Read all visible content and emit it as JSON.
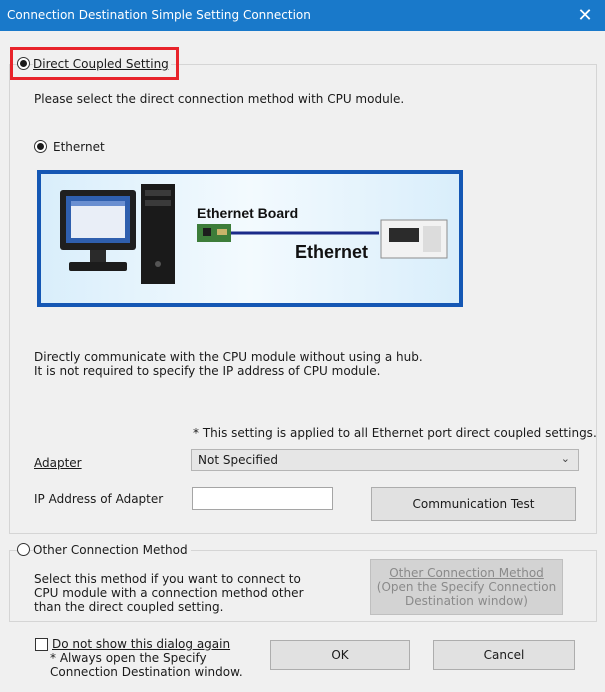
{
  "window": {
    "title": "Connection Destination Simple Setting Connection",
    "close_glyph": "✕"
  },
  "direct": {
    "label": "Direct Coupled Setting",
    "description": "Please select the direct connection method with CPU module.",
    "ethernet_label": "Ethernet",
    "diagram": {
      "board_label": "Ethernet Board",
      "cable_label": "Ethernet"
    },
    "info_line1": "Directly communicate with the CPU module without using a hub.",
    "info_line2": "It is not required to specify the IP address of CPU module.",
    "note": "* This setting is applied to all Ethernet port direct coupled settings.",
    "adapter_label": "Adapter",
    "adapter_value": "Not Specified",
    "ip_label": "IP Address of Adapter",
    "ip_value": "",
    "test_button": "Communication Test"
  },
  "other": {
    "label": "Other Connection Method",
    "description_line1": "Select this method if you want to connect to",
    "description_line2": "CPU module with a connection method other",
    "description_line3": "than the direct coupled setting.",
    "button_line1": "Other Connection Method",
    "button_line2": "(Open the Specify Connection",
    "button_line3": "Destination window)"
  },
  "footer": {
    "checkbox_label": "Do not show this dialog again",
    "checkbox_note1": "* Always open the Specify",
    "checkbox_note2": "Connection Destination window.",
    "ok_label": "OK",
    "cancel_label": "Cancel"
  },
  "colors": {
    "titlebar": "#1979ca",
    "highlight": "#e8232a",
    "diagram_border": "#1557b4"
  }
}
